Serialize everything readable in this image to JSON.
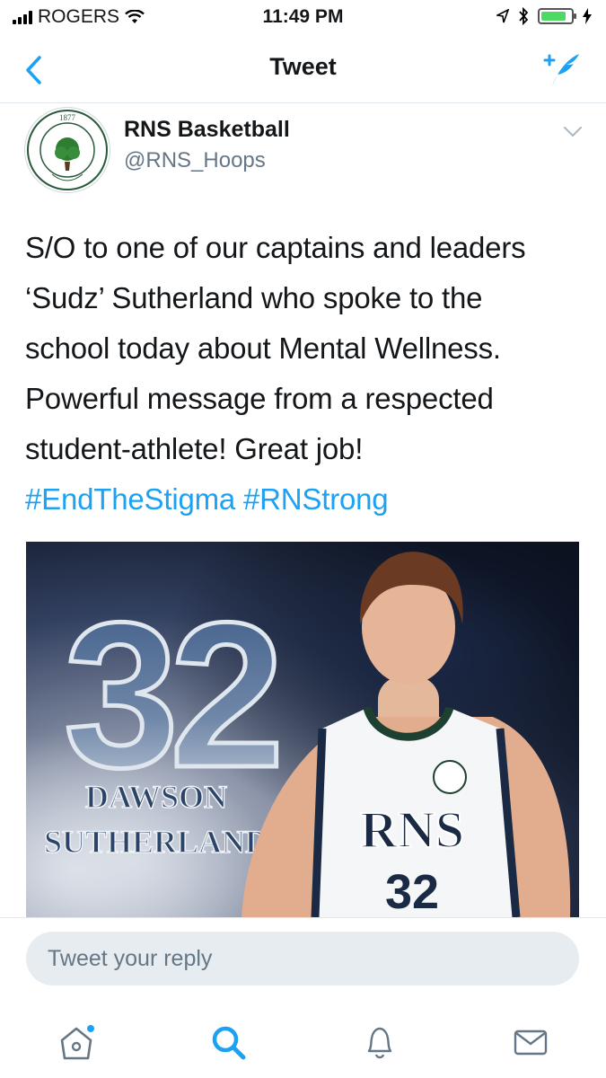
{
  "status_bar": {
    "carrier": "ROGERS",
    "time": "11:49 PM",
    "battery_level": 0.85
  },
  "nav": {
    "title": "Tweet",
    "back_icon": "chevron-left-icon",
    "compose_icon": "compose-tweet-icon"
  },
  "tweet": {
    "author_name": "RNS Basketball",
    "author_handle": "@RNS_Hoops",
    "avatar_year": "1877",
    "avatar_school": "ROTHESAY NETHERWOOD SCHOOL",
    "text_lines": [
      "S/O to one of our captains and leaders",
      "‘Sudz’ Sutherland who spoke to the",
      "school today about Mental Wellness.",
      "Powerful message from a respected",
      "student-athlete! Great job!"
    ],
    "hashtags": "#EndTheStigma #RNStrong",
    "media": {
      "number": "32",
      "first_name": "DAWSON",
      "last_name": "SUTHERLAND",
      "jersey_text": "RNS",
      "jersey_number": "32"
    }
  },
  "reply": {
    "placeholder": "Tweet your reply"
  },
  "tabs": [
    {
      "name": "home",
      "icon": "home-icon"
    },
    {
      "name": "search",
      "icon": "search-icon"
    },
    {
      "name": "notifications",
      "icon": "bell-icon"
    },
    {
      "name": "messages",
      "icon": "envelope-icon"
    }
  ],
  "colors": {
    "accent": "#1da1f2",
    "text": "#14171a",
    "secondary": "#657786"
  }
}
